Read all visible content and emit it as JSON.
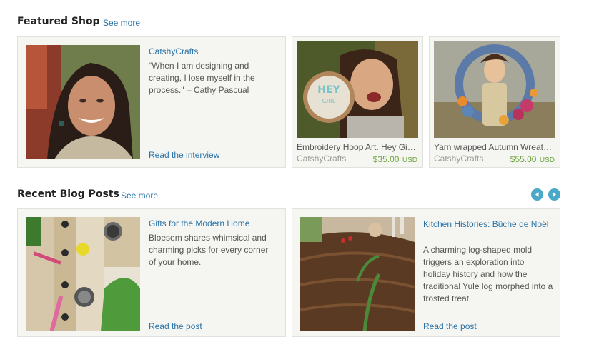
{
  "featured": {
    "title": "Featured Shop",
    "see_more": "See more",
    "shop_name": "CatshyCrafts",
    "quote": "\"When I am designing and creating, I lose myself in the process.\" – Cathy Pascual",
    "read_interview": "Read the interview",
    "items": [
      {
        "title": "Embroidery Hoop Art. Hey Gi…",
        "shop": "CatshyCrafts",
        "price": "$35.00",
        "currency": "USD"
      },
      {
        "title": "Yarn wrapped Autumn Wreat…",
        "shop": "CatshyCrafts",
        "price": "$55.00",
        "currency": "USD"
      }
    ],
    "hoop_text": [
      "HEY",
      "GIRL"
    ]
  },
  "blog": {
    "title": "Recent Blog Posts",
    "see_more": "See more",
    "posts": [
      {
        "title": "Gifts for the Modern Home",
        "summary": "Bloesem shares whimsical and charming picks for every corner of your home.",
        "read_more": "Read the post"
      },
      {
        "title": "Kitchen Histories: Bûche de Noël",
        "summary": "A charming log-shaped mold triggers an exploration into holiday history and how the traditional Yule log morphed into a frosted treat.",
        "read_more": "Read the post"
      }
    ]
  },
  "colors": {
    "link": "#2a73a8",
    "price": "#6aa33a",
    "arrow": "#4aa9c9"
  },
  "icons": {
    "prev": "chevron-left-icon",
    "next": "chevron-right-icon"
  }
}
